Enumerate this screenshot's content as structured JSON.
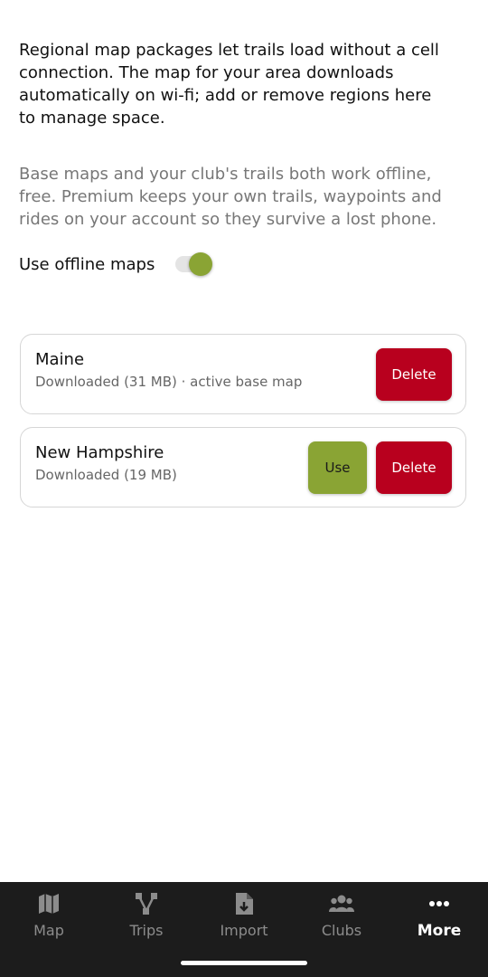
{
  "offline": {
    "intro_text": "Regional map packages let trails load without a cell connection. The map for your area downloads automatically on wi-fi; add or remove regions here to manage space.",
    "note_text": "Base maps and your club's trails both work offline, free. Premium keeps your own trails, waypoints and rides on your account so they survive a lost phone.",
    "toggle_label": "Use offline maps",
    "toggle_on": true
  },
  "regions": [
    {
      "name": "Maine",
      "status": "Downloaded (31 MB) · active base map",
      "delete_label": "Delete"
    },
    {
      "name": "New Hampshire",
      "status": "Downloaded (19 MB)",
      "use_label": "Use",
      "delete_label": "Delete"
    }
  ],
  "tabbar": {
    "items": [
      {
        "label": "Map",
        "icon": "map-icon"
      },
      {
        "label": "Trips",
        "icon": "route-icon"
      },
      {
        "label": "Import",
        "icon": "file-import-icon"
      },
      {
        "label": "Clubs",
        "icon": "users-icon"
      },
      {
        "label": "More",
        "icon": "more-dots-icon"
      }
    ],
    "active": "More"
  },
  "colors": {
    "accent_green": "#8aa434",
    "delete_red": "#b8001e",
    "tabbar_bg": "#1c1c1c",
    "tab_inactive": "#8c8c8c",
    "tab_active": "#ffffff"
  }
}
